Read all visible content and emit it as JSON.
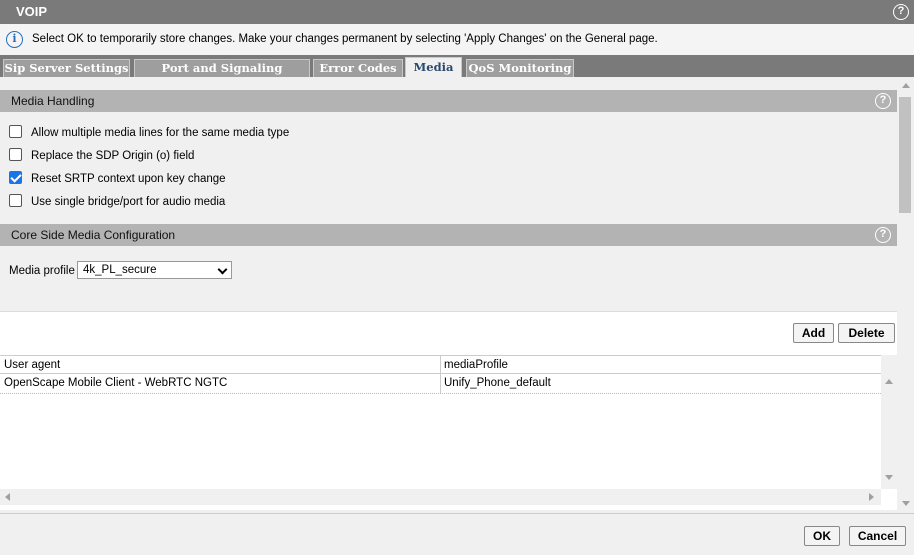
{
  "window": {
    "title": "VOIP",
    "help_label": "?"
  },
  "info": {
    "message": "Select OK to temporarily store changes. Make your changes permanent by selecting 'Apply Changes' on the General page."
  },
  "tabs": [
    {
      "label": "Sip Server Settings",
      "active": false
    },
    {
      "label": "Port and Signaling Settings",
      "active": false
    },
    {
      "label": "Error Codes",
      "active": false
    },
    {
      "label": "Media",
      "active": true
    },
    {
      "label": "QoS Monitoring",
      "active": false
    }
  ],
  "media_handling": {
    "title": "Media Handling",
    "options": [
      {
        "label": "Allow multiple media lines for the same media type",
        "checked": false
      },
      {
        "label": "Replace the SDP Origin (o) field",
        "checked": false
      },
      {
        "label": "Reset SRTP context upon key change",
        "checked": true
      },
      {
        "label": "Use single bridge/port for audio media",
        "checked": false
      }
    ]
  },
  "core_side": {
    "title": "Core Side Media Configuration",
    "media_profile_label": "Media profile",
    "media_profile_value": "4k_PL_secure"
  },
  "table": {
    "add_label": "Add",
    "delete_label": "Delete",
    "columns": [
      "User agent",
      "mediaProfile"
    ],
    "rows": [
      [
        "OpenScape Mobile Client - WebRTC NGTC",
        "Unify_Phone_default"
      ]
    ]
  },
  "footer": {
    "ok_label": "OK",
    "cancel_label": "Cancel"
  },
  "colors": {
    "header_gray": "#7a7a7a",
    "section_gray": "#b3b3b3",
    "checkbox_blue": "#1a73e8",
    "info_blue": "#2a6ebb"
  }
}
